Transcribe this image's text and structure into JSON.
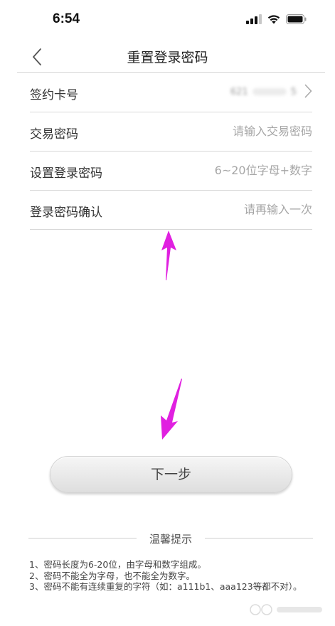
{
  "status_bar": {
    "time": "6:54"
  },
  "nav": {
    "title": "重置登录密码"
  },
  "form": {
    "card": {
      "label": "签约卡号",
      "value_left": "621",
      "value_right": "5"
    },
    "trade_password": {
      "label": "交易密码",
      "placeholder": "请输入交易密码"
    },
    "login_password": {
      "label": "设置登录密码",
      "placeholder": "6~20位字母+数字"
    },
    "login_password_confirm": {
      "label": "登录密码确认",
      "placeholder": "请再输入一次"
    }
  },
  "next_button": {
    "label": "下一步"
  },
  "tips": {
    "title": "温馨提示",
    "items": [
      "1、密码长度为6-20位，由字母和数字组成。",
      "2、密码不能全为字母，也不能全为数字。",
      "3、密码不能有连续重复的字符（如：a111b1、aaa123等都不对）。"
    ]
  },
  "colors": {
    "annotation_arrow": "#e020e0",
    "divider": "#d8d8d8",
    "placeholder": "#a6a6a6"
  },
  "icons": {
    "back": "chevron-left-icon",
    "card_more": "chevron-right-icon",
    "signal": "signal-icon",
    "wifi": "wifi-icon",
    "battery": "battery-icon"
  }
}
